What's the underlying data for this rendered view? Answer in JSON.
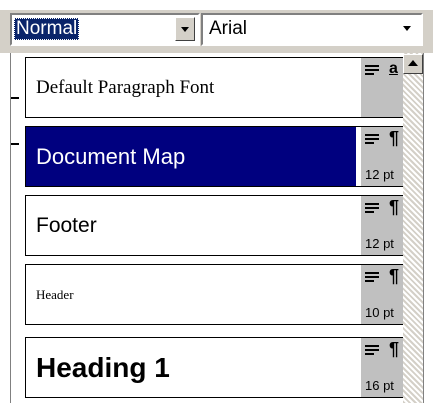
{
  "toolbar": {
    "style_combo_value": "Normal",
    "font_combo_value": "Arial"
  },
  "style_list": {
    "items": [
      {
        "label": "Default Paragraph Font",
        "kind": "a",
        "size": "",
        "selected": false
      },
      {
        "label": "Document Map",
        "kind": "¶",
        "size": "12 pt",
        "selected": true
      },
      {
        "label": "Footer",
        "kind": "¶",
        "size": "12 pt",
        "selected": false
      },
      {
        "label": "Header",
        "kind": "¶",
        "size": "10 pt",
        "selected": false
      },
      {
        "label": "Heading 1",
        "kind": "¶",
        "size": "16 pt",
        "selected": false
      }
    ]
  },
  "colors": {
    "selection": "#00007f",
    "toolbar_face": "#d4d0c8",
    "meta_panel": "#c0c0c0"
  },
  "icons": {
    "align": "align-left-icon",
    "dropdown": "chevron-down-icon",
    "scroll_up": "arrow-up-icon"
  }
}
